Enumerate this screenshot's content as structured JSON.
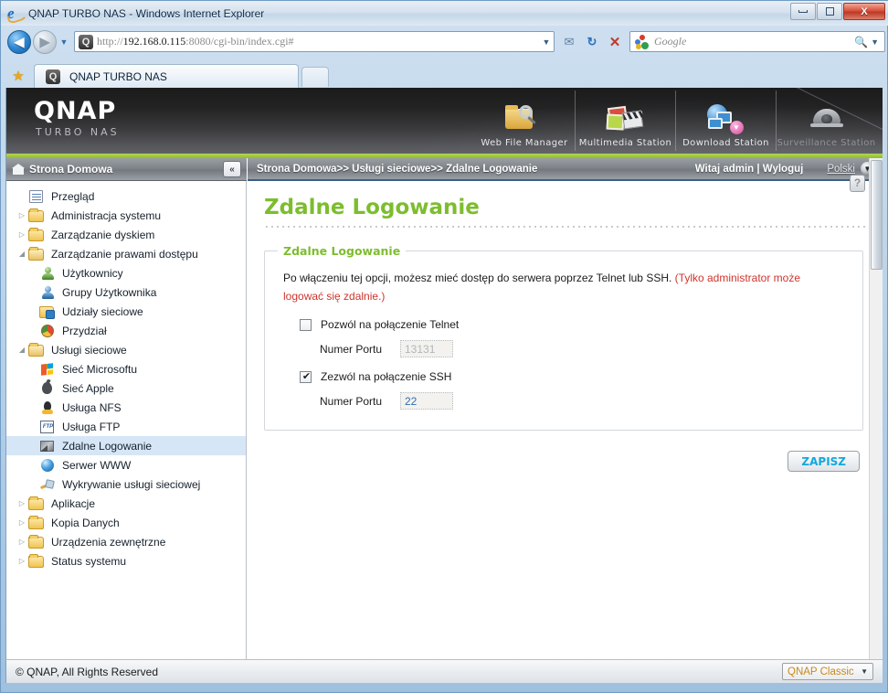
{
  "window": {
    "title": "QNAP TURBO NAS - Windows Internet Explorer",
    "minimize_label": "Minimize",
    "maximize_label": "Maximize",
    "close_label": "X"
  },
  "browser": {
    "back_label": "◀",
    "forward_label": "▶",
    "history_caret": "▼",
    "url_scheme": "http://",
    "url_host": "192.168.0.115",
    "url_rest": ":8080/cgi-bin/index.cgi#",
    "url_full": "http://192.168.0.115:8080/cgi-bin/index.cgi#",
    "address_caret": "▼",
    "feeds_label": "✉",
    "refresh_label": "↻",
    "stop_label": "✕",
    "search_placeholder": "Google",
    "search_caret": "▼",
    "favorites_label": "★",
    "tab_title": "QNAP TURBO NAS",
    "new_tab_label": ""
  },
  "banner": {
    "logo": "QNAP",
    "logo_sub": "TURBO NAS",
    "apps": [
      {
        "label": "Web File Manager",
        "icon": "web-file-manager-icon",
        "dim": false
      },
      {
        "label": "Multimedia Station",
        "icon": "multimedia-station-icon",
        "dim": false
      },
      {
        "label": "Download Station",
        "icon": "download-station-icon",
        "dim": false
      },
      {
        "label": "Surveillance Station",
        "icon": "surveillance-station-icon",
        "dim": true
      }
    ]
  },
  "sidebar": {
    "header": "Strona Domowa",
    "collapse_label": "«",
    "items": [
      {
        "label": "Przegląd",
        "icon": "overview-icon",
        "level": "leaf-root",
        "twisty": "",
        "selected": false
      },
      {
        "label": "Administracja systemu",
        "icon": "folder-icon",
        "level": "root",
        "twisty": "▷",
        "selected": false
      },
      {
        "label": "Zarządzanie dyskiem",
        "icon": "folder-icon",
        "level": "root",
        "twisty": "▷",
        "selected": false
      },
      {
        "label": "Zarządzanie prawami dostępu",
        "icon": "folder-open-icon",
        "level": "root",
        "twisty": "◢",
        "selected": false
      },
      {
        "label": "Użytkownicy",
        "icon": "user-icon",
        "level": "child",
        "twisty": "",
        "selected": false
      },
      {
        "label": "Grupy Użytkownika",
        "icon": "user-group-icon",
        "level": "child",
        "twisty": "",
        "selected": false
      },
      {
        "label": "Udziały sieciowe",
        "icon": "network-share-icon",
        "level": "child",
        "twisty": "",
        "selected": false
      },
      {
        "label": "Przydział",
        "icon": "quota-icon",
        "level": "child",
        "twisty": "",
        "selected": false
      },
      {
        "label": "Usługi sieciowe",
        "icon": "folder-open-icon",
        "level": "root",
        "twisty": "◢",
        "selected": false
      },
      {
        "label": "Sieć Microsoftu",
        "icon": "microsoft-network-icon",
        "level": "child",
        "twisty": "",
        "selected": false
      },
      {
        "label": "Sieć Apple",
        "icon": "apple-network-icon",
        "level": "child",
        "twisty": "",
        "selected": false
      },
      {
        "label": "Usługa NFS",
        "icon": "nfs-icon",
        "level": "child",
        "twisty": "",
        "selected": false
      },
      {
        "label": "Usługa FTP",
        "icon": "ftp-icon",
        "level": "child",
        "twisty": "",
        "selected": false
      },
      {
        "label": "Zdalne Logowanie",
        "icon": "remote-login-icon",
        "level": "child",
        "twisty": "",
        "selected": true
      },
      {
        "label": "Serwer WWW",
        "icon": "web-server-icon",
        "level": "child",
        "twisty": "",
        "selected": false
      },
      {
        "label": "Wykrywanie usługi sieciowej",
        "icon": "network-discovery-icon",
        "level": "child",
        "twisty": "",
        "selected": false
      },
      {
        "label": "Aplikacje",
        "icon": "folder-icon",
        "level": "root",
        "twisty": "▷",
        "selected": false
      },
      {
        "label": "Kopia Danych",
        "icon": "folder-icon",
        "level": "root",
        "twisty": "▷",
        "selected": false
      },
      {
        "label": "Urządzenia zewnętrzne",
        "icon": "folder-icon",
        "level": "root",
        "twisty": "▷",
        "selected": false
      },
      {
        "label": "Status systemu",
        "icon": "folder-icon",
        "level": "root",
        "twisty": "▷",
        "selected": false
      }
    ]
  },
  "crumbbar": {
    "breadcrumb": "Strona Domowa>> Usługi sieciowe>> Zdalne Logowanie",
    "welcome": "Witaj admin  |  Wyloguj",
    "language": "Polski",
    "language_caret": "▼"
  },
  "main": {
    "page_title": "Zdalne Logowanie",
    "help_label": "?",
    "fieldset_legend": "Zdalne Logowanie",
    "description_normal": "Po włączeniu tej opcji, możesz mieć dostęp do serwera poprzez Telnet lub SSH. ",
    "description_warning": "(Tylko administrator może logować się zdalnie.)",
    "telnet": {
      "checkbox_label": "Pozwól na połączenie Telnet",
      "checked": false,
      "port_label": "Numer Portu",
      "port_value": "13131",
      "port_enabled": false
    },
    "ssh": {
      "checkbox_label": "Zezwól na połączenie SSH",
      "checked": true,
      "port_label": "Numer Portu",
      "port_value": "22",
      "port_enabled": true
    },
    "save_label": "ZAPISZ"
  },
  "statusbar": {
    "copyright": "© QNAP, All Rights Reserved",
    "theme": "QNAP Classic",
    "theme_caret": "▼"
  },
  "colors": {
    "qnap_green": "#7dbd2e",
    "warning_red": "#d0342c",
    "save_cyan": "#13a8dd",
    "selection_blue": "#d6e6f6",
    "theme_orange": "#c9881f"
  }
}
